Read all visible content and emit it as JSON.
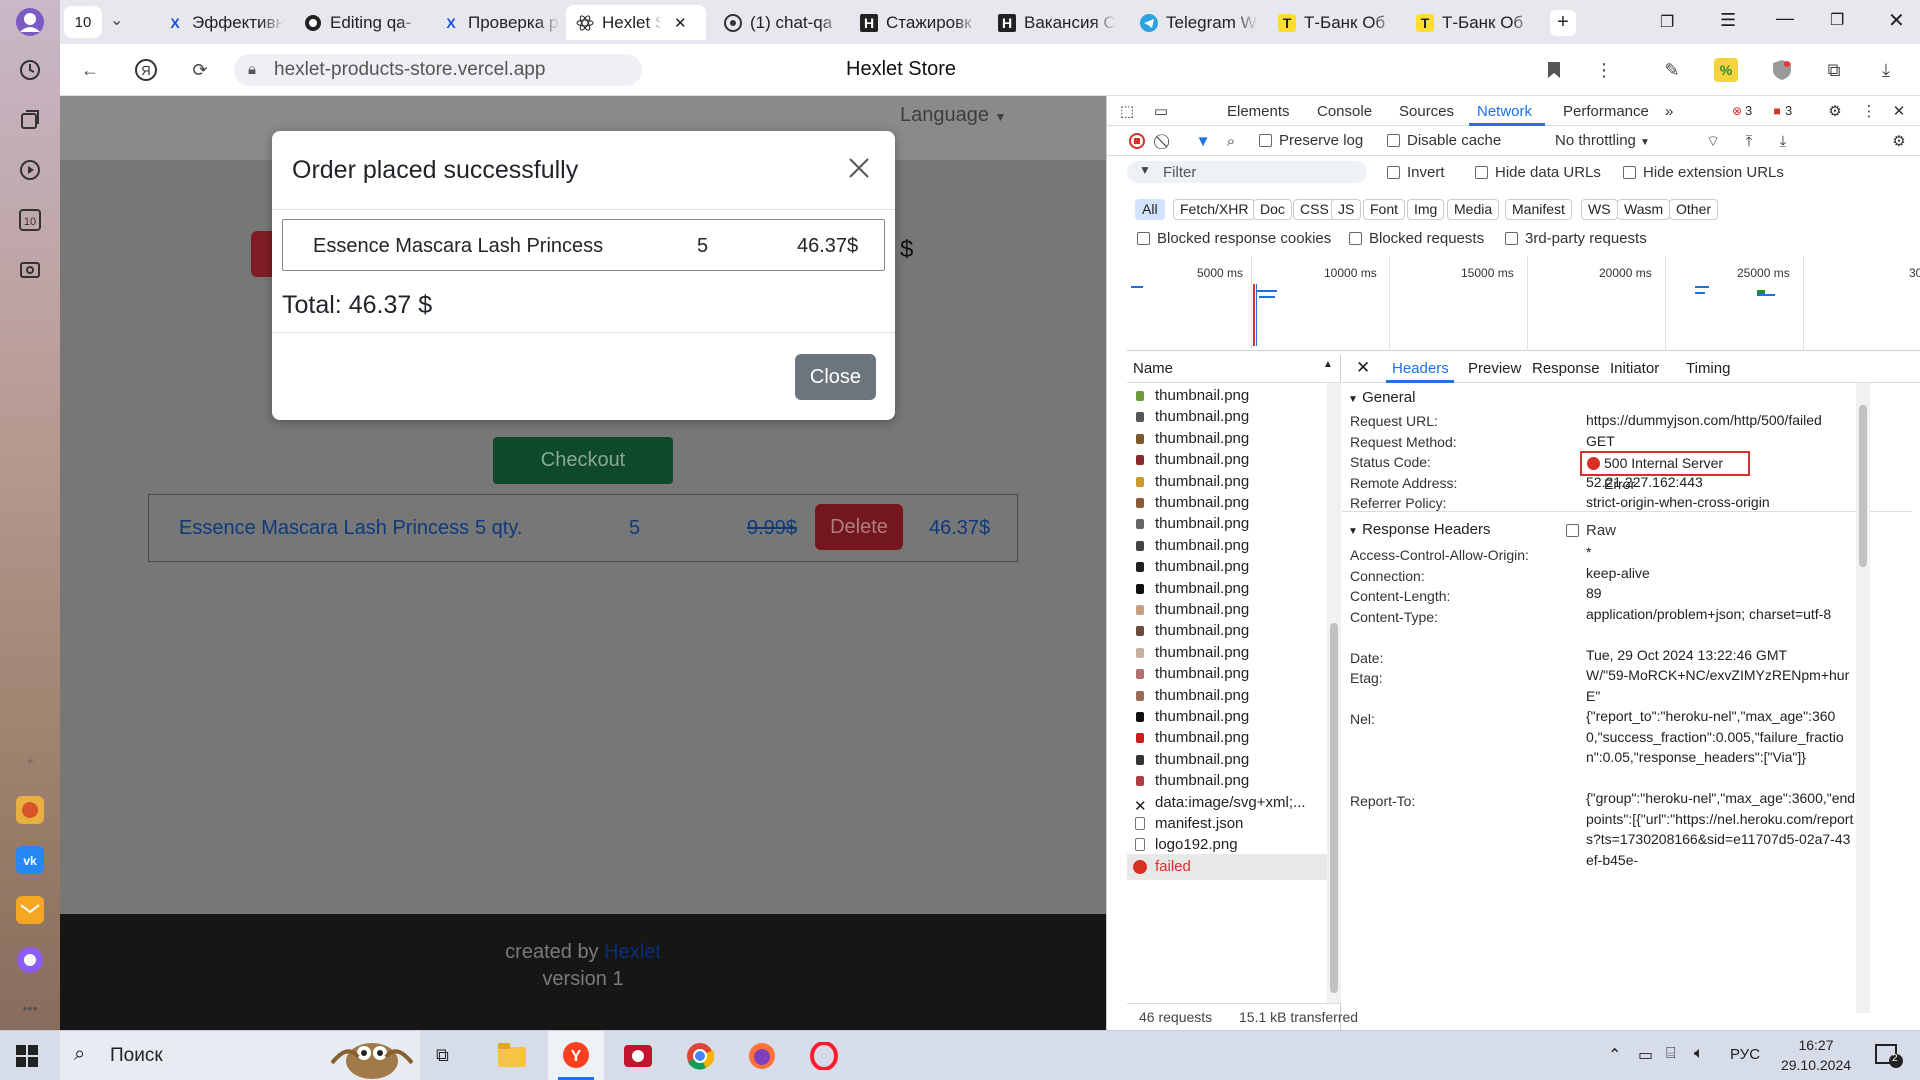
{
  "browser": {
    "tab_counter": "10",
    "tabs": [
      {
        "label": "Эффективн",
        "icon": "yandex-x-icon"
      },
      {
        "label": "Editing qa-",
        "icon": "github-icon"
      },
      {
        "label": "Проверка р",
        "icon": "yandex-x-icon"
      },
      {
        "label": "Hexlet S",
        "icon": "react-icon",
        "active": true
      },
      {
        "label": "(1) chat-qa",
        "icon": "chat-icon"
      },
      {
        "label": "Стажировк",
        "icon": "hexlet-h-icon"
      },
      {
        "label": "Вакансия С",
        "icon": "hexlet-h-icon"
      },
      {
        "label": "Telegram W",
        "icon": "telegram-icon"
      },
      {
        "label": "Т-Банк Об",
        "icon": "tbank-icon"
      },
      {
        "label": "Т-Банк Об",
        "icon": "tbank-icon"
      }
    ],
    "url": "hexlet-products-store.vercel.app",
    "page_title": "Hexlet Store"
  },
  "page": {
    "language": "Language",
    "currency_symbol": "$",
    "checkout": "Checkout",
    "cart_row": {
      "name": "Essence Mascara Lash Princess",
      "qty": "5 qty.",
      "count": "5",
      "old_price": "9.99$",
      "delete": "Delete",
      "total": "46.37$"
    },
    "footer": {
      "created_by": "created by",
      "link": "Hexlet",
      "version": "version 1"
    }
  },
  "modal": {
    "title": "Order placed successfully",
    "item_name": "Essence Mascara Lash Princess",
    "item_qty": "5",
    "item_price": "46.37$",
    "total": "Total: 46.37 $",
    "close": "Close"
  },
  "devtools": {
    "tabs": [
      "Elements",
      "Console",
      "Sources",
      "Network",
      "Performance"
    ],
    "active_tab": "Network",
    "errors": "3",
    "warnings": "3",
    "preserve_log": "Preserve log",
    "disable_cache": "Disable cache",
    "throttling": "No throttling",
    "filter_placeholder": "Filter",
    "invert": "Invert",
    "hide_data_urls": "Hide data URLs",
    "hide_extension_urls": "Hide extension URLs",
    "type_filters": [
      "All",
      "Fetch/XHR",
      "Doc",
      "CSS",
      "JS",
      "Font",
      "Img",
      "Media",
      "Manifest",
      "WS",
      "Wasm",
      "Other"
    ],
    "blocked_cookies": "Blocked response cookies",
    "blocked_requests": "Blocked requests",
    "third_party": "3rd-party requests",
    "timeline_marks": [
      "5000 ms",
      "10000 ms",
      "15000 ms",
      "20000 ms",
      "25000 ms",
      "30"
    ],
    "name_header": "Name",
    "requests": [
      "thumbnail.png",
      "thumbnail.png",
      "thumbnail.png",
      "thumbnail.png",
      "thumbnail.png",
      "thumbnail.png",
      "thumbnail.png",
      "thumbnail.png",
      "thumbnail.png",
      "thumbnail.png",
      "thumbnail.png",
      "thumbnail.png",
      "thumbnail.png",
      "thumbnail.png",
      "thumbnail.png",
      "thumbnail.png",
      "thumbnail.png",
      "thumbnail.png",
      "thumbnail.png",
      "data:image/svg+xml;...",
      "manifest.json",
      "logo192.png",
      "failed"
    ],
    "summary_requests": "46 requests",
    "summary_transferred": "15.1 kB transferred",
    "detail_tabs": [
      "Headers",
      "Preview",
      "Response",
      "Initiator",
      "Timing"
    ],
    "general_title": "General",
    "general": [
      {
        "k": "Request URL:",
        "v": "https://dummyjson.com/http/500/failed"
      },
      {
        "k": "Request Method:",
        "v": "GET"
      },
      {
        "k": "Status Code:",
        "v": "500 Internal Server Error"
      },
      {
        "k": "Remote Address:",
        "v": "52.21.227.162:443"
      },
      {
        "k": "Referrer Policy:",
        "v": "strict-origin-when-cross-origin"
      }
    ],
    "response_headers_title": "Response Headers",
    "raw": "Raw",
    "response_headers": [
      {
        "k": "Access-Control-Allow-Origin:",
        "v": "*"
      },
      {
        "k": "Connection:",
        "v": "keep-alive"
      },
      {
        "k": "Content-Length:",
        "v": "89"
      },
      {
        "k": "Content-Type:",
        "v": "application/problem+json; charset=utf-8"
      },
      {
        "k": "Date:",
        "v": "Tue, 29 Oct 2024 13:22:46 GMT"
      },
      {
        "k": "Etag:",
        "v": "W/\"59-MoRCK+NC/exvZIMYzRENpm+hurE\""
      },
      {
        "k": "Nel:",
        "v": "{\"report_to\":\"heroku-nel\",\"max_age\":3600,\"success_fraction\":0.005,\"failure_fraction\":0.05,\"response_headers\":[\"Via\"]}"
      },
      {
        "k": "Report-To:",
        "v": "{\"group\":\"heroku-nel\",\"max_age\":3600,\"endpoints\":[{\"url\":\"https://nel.heroku.com/reports?ts=1730208166&sid=e11707d5-02a7-43ef-b45e-"
      }
    ]
  },
  "taskbar": {
    "search": "Поиск",
    "lang": "РУС",
    "time": "16:27",
    "date": "29.10.2024",
    "notifications": "2"
  },
  "colors": {
    "accent_blue": "#1a73e8",
    "error_red": "#d93025",
    "highlight_box": "#d32f2f"
  }
}
